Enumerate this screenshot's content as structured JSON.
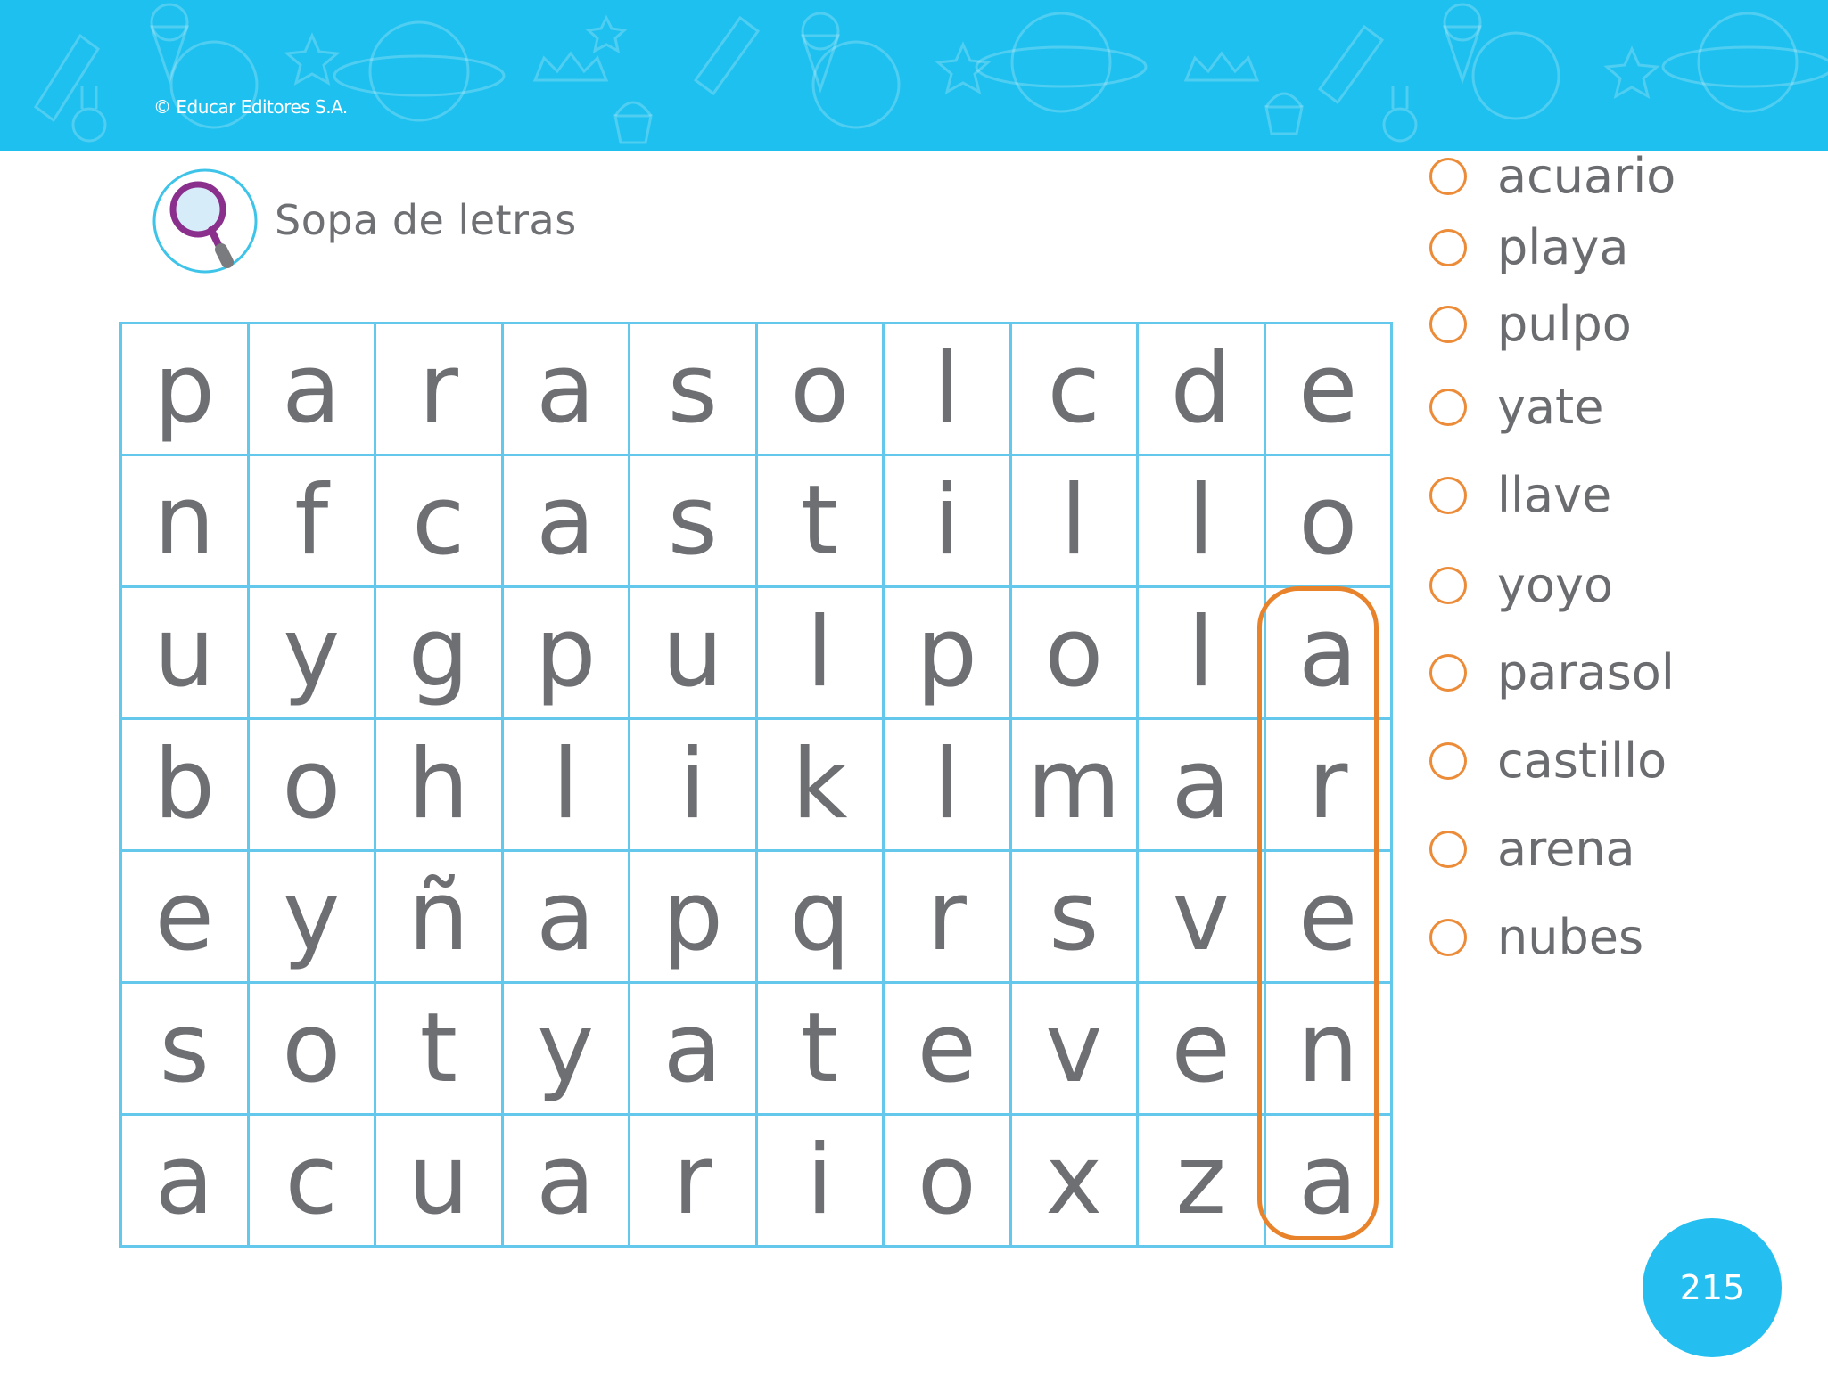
{
  "header": {
    "copyright": "© Educar Editores S.A."
  },
  "activity": {
    "title": "Sopa de letras",
    "icon": "magnifying-glass-icon"
  },
  "puzzle": {
    "rows": [
      [
        "p",
        "a",
        "r",
        "a",
        "s",
        "o",
        "l",
        "c",
        "d",
        "e"
      ],
      [
        "n",
        "f",
        "c",
        "a",
        "s",
        "t",
        "i",
        "l",
        "l",
        "o"
      ],
      [
        "u",
        "y",
        "g",
        "p",
        "u",
        "l",
        "p",
        "o",
        "l",
        "a"
      ],
      [
        "b",
        "o",
        "h",
        "l",
        "i",
        "k",
        "l",
        "m",
        "a",
        "r"
      ],
      [
        "e",
        "y",
        "ñ",
        "a",
        "p",
        "q",
        "r",
        "s",
        "v",
        "e"
      ],
      [
        "s",
        "o",
        "t",
        "y",
        "a",
        "t",
        "e",
        "v",
        "e",
        "n"
      ],
      [
        "a",
        "c",
        "u",
        "a",
        "r",
        "i",
        "o",
        "x",
        "z",
        "a"
      ]
    ],
    "highlighted_word": "arena"
  },
  "words": [
    {
      "label": "acuario"
    },
    {
      "label": "playa"
    },
    {
      "label": "pulpo"
    },
    {
      "label": "yate"
    },
    {
      "label": "llave"
    },
    {
      "label": "yoyo"
    },
    {
      "label": "parasol"
    },
    {
      "label": "castillo"
    },
    {
      "label": "arena"
    },
    {
      "label": "nubes"
    }
  ],
  "page": {
    "number": "215"
  },
  "colors": {
    "banner": "#1ec0ef",
    "grid_border": "#64c7ec",
    "highlight": "#e8832c",
    "text": "#6e6f72"
  }
}
